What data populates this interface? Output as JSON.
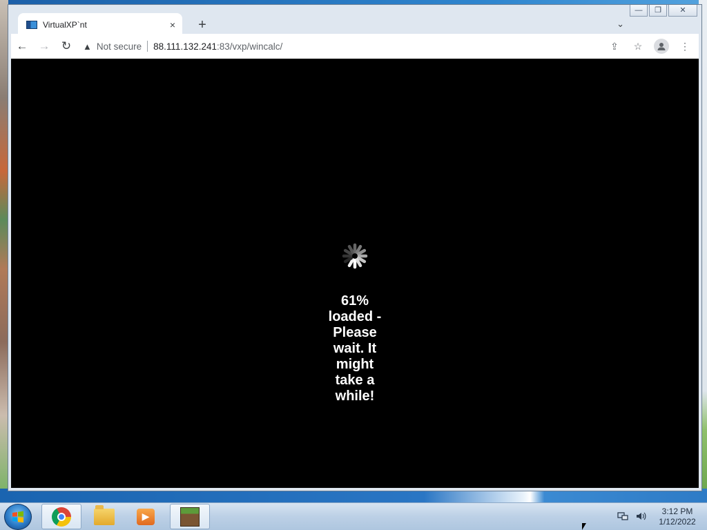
{
  "browser": {
    "tab": {
      "title": "VirtualXP`nt",
      "close_symbol": "×"
    },
    "new_tab_symbol": "+",
    "tab_list_symbol": "⌄",
    "toolbar": {
      "back_symbol": "←",
      "forward_symbol": "→",
      "reload_symbol": "↻",
      "security_warning_symbol": "▲",
      "security_label": "Not secure",
      "url_host": "88.111.132.241",
      "url_path": ":83/vxp/wincalc/",
      "share_symbol": "⇪",
      "bookmark_symbol": "☆",
      "menu_symbol": "⋮"
    }
  },
  "window_controls": {
    "minimize": "—",
    "restore": "❐",
    "close": "✕"
  },
  "page": {
    "loading_progress_percent": 61,
    "loading_message": "61% loaded - Please wait. It might take a while!"
  },
  "taskbar": {
    "apps": [
      {
        "name": "Google Chrome",
        "icon": "chrome-icon",
        "active": true
      },
      {
        "name": "Windows Explorer",
        "icon": "folder-icon",
        "active": false
      },
      {
        "name": "Windows Media Player",
        "icon": "media-player-icon",
        "active": false
      },
      {
        "name": "Minecraft",
        "icon": "minecraft-icon",
        "active": true
      }
    ],
    "clock": {
      "time": "3:12 PM",
      "date": "1/12/2022"
    }
  },
  "colors": {
    "content_background": "#000000",
    "loading_text": "#ffffff",
    "taskbar": "#bcd0e6"
  }
}
